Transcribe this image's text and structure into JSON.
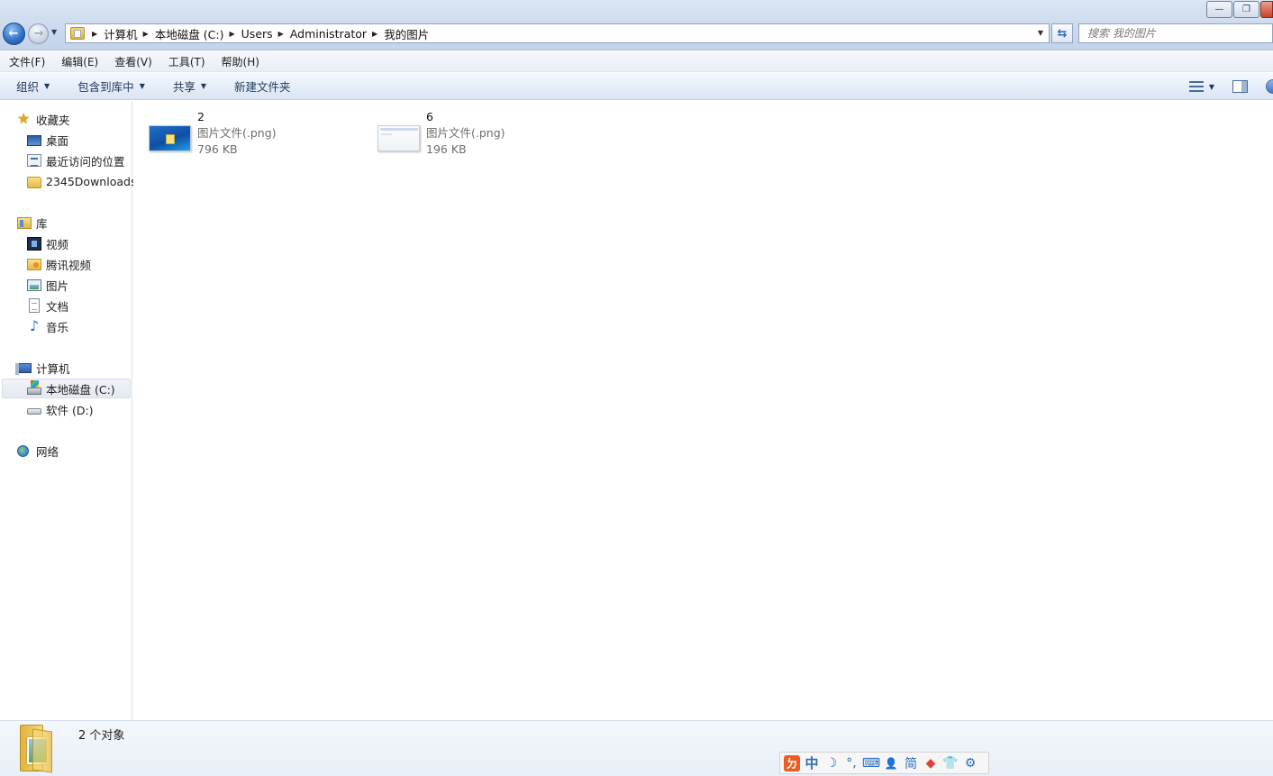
{
  "window": {
    "controls": {
      "minimize": "—",
      "maximize": "❐",
      "close": "✕"
    }
  },
  "address_bar": {
    "crumbs": [
      "计算机",
      "本地磁盘 (C:)",
      "Users",
      "Administrator",
      "我的图片"
    ],
    "search_placeholder": "搜索 我的图片"
  },
  "menu": {
    "items": [
      "文件(F)",
      "编辑(E)",
      "查看(V)",
      "工具(T)",
      "帮助(H)"
    ]
  },
  "command_bar": {
    "organize": "组织",
    "include_in_library": "包含到库中",
    "share": "共享",
    "new_folder": "新建文件夹"
  },
  "nav_pane": {
    "favorites": {
      "label": "收藏夹",
      "items": [
        "桌面",
        "最近访问的位置",
        "2345Downloads"
      ]
    },
    "libraries": {
      "label": "库",
      "items": [
        "视频",
        "腾讯视频",
        "图片",
        "文档",
        "音乐"
      ]
    },
    "computer": {
      "label": "计算机",
      "items": [
        "本地磁盘 (C:)",
        "软件 (D:)"
      ],
      "selected": "本地磁盘 (C:)"
    },
    "network": {
      "label": "网络"
    }
  },
  "files": [
    {
      "name": "2",
      "type": "图片文件(.png)",
      "size": "796 KB",
      "icon": "png-thumbnail-desktop"
    },
    {
      "name": "6",
      "type": "图片文件(.png)",
      "size": "196 KB",
      "icon": "png-thumbnail-window"
    }
  ],
  "details_pane": {
    "object_count": "2 个对象"
  },
  "ime_toolbar": {
    "logo": "ㄉ",
    "mode": "中",
    "halfwidth": "☽",
    "punct": "°,",
    "keyboard": "⌨",
    "user": "👤",
    "simplified": "简",
    "skin": "👕",
    "settings": "⚙"
  }
}
